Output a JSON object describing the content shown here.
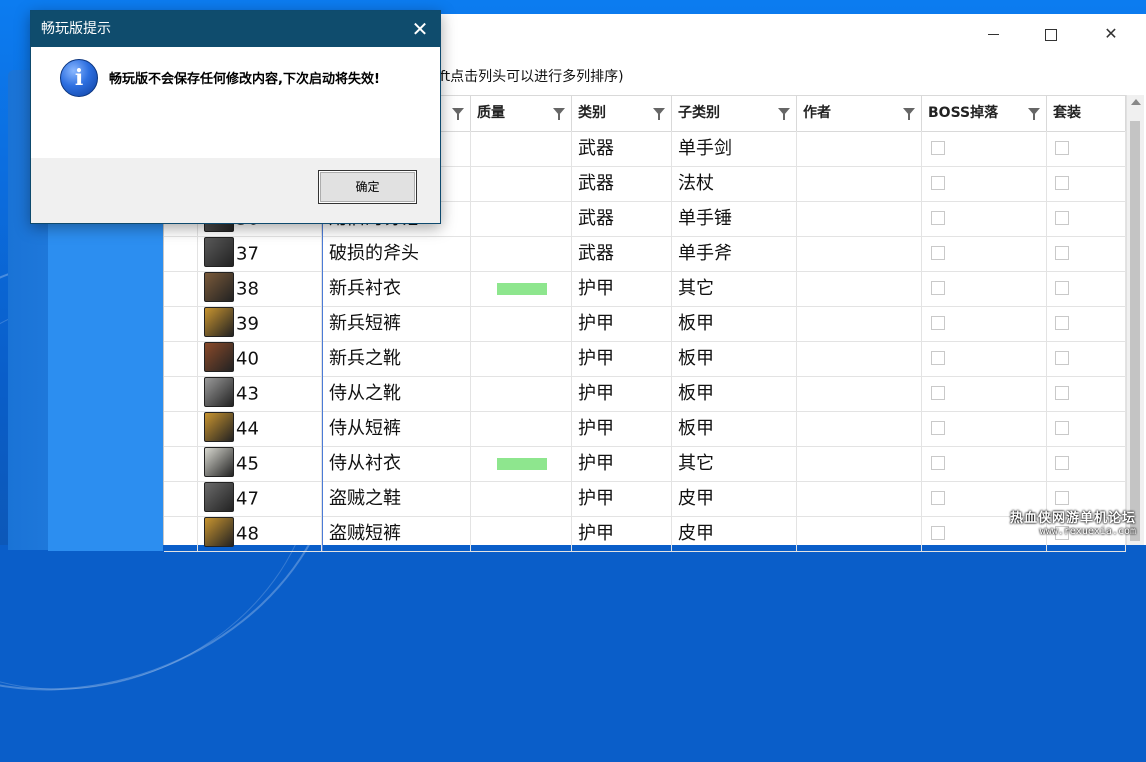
{
  "main_window": {
    "hint": "ft点击列头可以进行多列排序)",
    "minimize_glyph": "",
    "close_glyph": "✕"
  },
  "grid": {
    "columns": [
      {
        "label": ""
      },
      {
        "label": ""
      },
      {
        "label": ""
      },
      {
        "label": "质量"
      },
      {
        "label": "类别"
      },
      {
        "label": "子类别"
      },
      {
        "label": "作者"
      },
      {
        "label": "BOSS掉落"
      },
      {
        "label": "套装"
      }
    ],
    "rows": [
      {
        "id": "",
        "name": "",
        "quality_color": "",
        "category": "武器",
        "subcategory": "单手剑",
        "icon_color": ""
      },
      {
        "id": "",
        "name": "",
        "quality_color": "",
        "category": "武器",
        "subcategory": "法杖",
        "icon_color": ""
      },
      {
        "id": "36",
        "name": "用旧的钉锤",
        "quality_color": "",
        "category": "武器",
        "subcategory": "单手锤",
        "icon_color": "#6b6b6b"
      },
      {
        "id": "37",
        "name": "破损的斧头",
        "quality_color": "",
        "category": "武器",
        "subcategory": "单手斧",
        "icon_color": "#5a5a5a"
      },
      {
        "id": "38",
        "name": "新兵衬衣",
        "quality_color": "#8ee68e",
        "category": "护甲",
        "subcategory": "其它",
        "icon_color": "#7a5a3a"
      },
      {
        "id": "39",
        "name": "新兵短裤",
        "quality_color": "",
        "category": "护甲",
        "subcategory": "板甲",
        "icon_color": "#c89430"
      },
      {
        "id": "40",
        "name": "新兵之靴",
        "quality_color": "",
        "category": "护甲",
        "subcategory": "板甲",
        "icon_color": "#8a4a2a"
      },
      {
        "id": "43",
        "name": "侍从之靴",
        "quality_color": "",
        "category": "护甲",
        "subcategory": "板甲",
        "icon_color": "#9a9a9a"
      },
      {
        "id": "44",
        "name": "侍从短裤",
        "quality_color": "",
        "category": "护甲",
        "subcategory": "板甲",
        "icon_color": "#c89430"
      },
      {
        "id": "45",
        "name": "侍从衬衣",
        "quality_color": "#8ee68e",
        "category": "护甲",
        "subcategory": "其它",
        "icon_color": "#d8d8d0"
      },
      {
        "id": "47",
        "name": "盗贼之鞋",
        "quality_color": "",
        "category": "护甲",
        "subcategory": "皮甲",
        "icon_color": "#6a6a6a"
      },
      {
        "id": "48",
        "name": "盗贼短裤",
        "quality_color": "",
        "category": "护甲",
        "subcategory": "皮甲",
        "icon_color": "#c89430"
      }
    ]
  },
  "dialog": {
    "title": "畅玩版提示",
    "close_glyph": "✕",
    "icon_glyph": "i",
    "message": "畅玩版不会保存任何修改内容,下次启动将失效!",
    "ok_label": "确定"
  },
  "watermark": {
    "line1": "热血侠网游单机论坛",
    "line2": "www.rexuexia.com"
  }
}
